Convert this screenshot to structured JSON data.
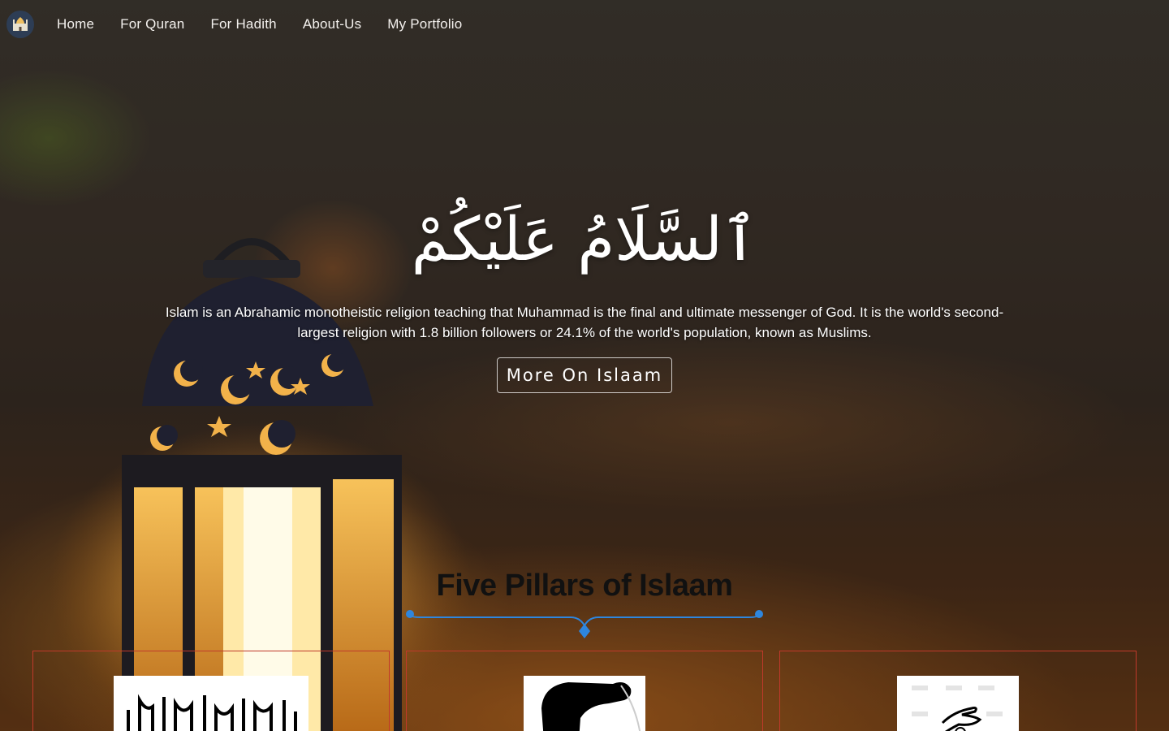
{
  "nav": {
    "logo_icon": "mosque-icon",
    "items": [
      {
        "label": "Home"
      },
      {
        "label": "For Quran"
      },
      {
        "label": "For Hadith"
      },
      {
        "label": "About-Us"
      },
      {
        "label": "My Portfolio"
      }
    ]
  },
  "hero": {
    "greeting": "ٱلسَّلَامُ عَلَيْكُمْ",
    "description": "Islam is an Abrahamic monotheistic religion teaching that Muhammad is the final and ultimate messenger of God. It is the world's second-largest religion with 1.8 billion followers or 24.1% of the world's population, known as Muslims.",
    "button_label": "More On Islaam"
  },
  "pillars": {
    "title": "Five Pillars of Islaam",
    "accent_color": "#2e86de",
    "card_border_color": "#c0392b",
    "cards": [
      {
        "image_icon": "shahada-calligraphy-icon"
      },
      {
        "image_icon": "prayer-bowing-icon"
      },
      {
        "image_icon": "charity-hand-icon"
      }
    ]
  }
}
